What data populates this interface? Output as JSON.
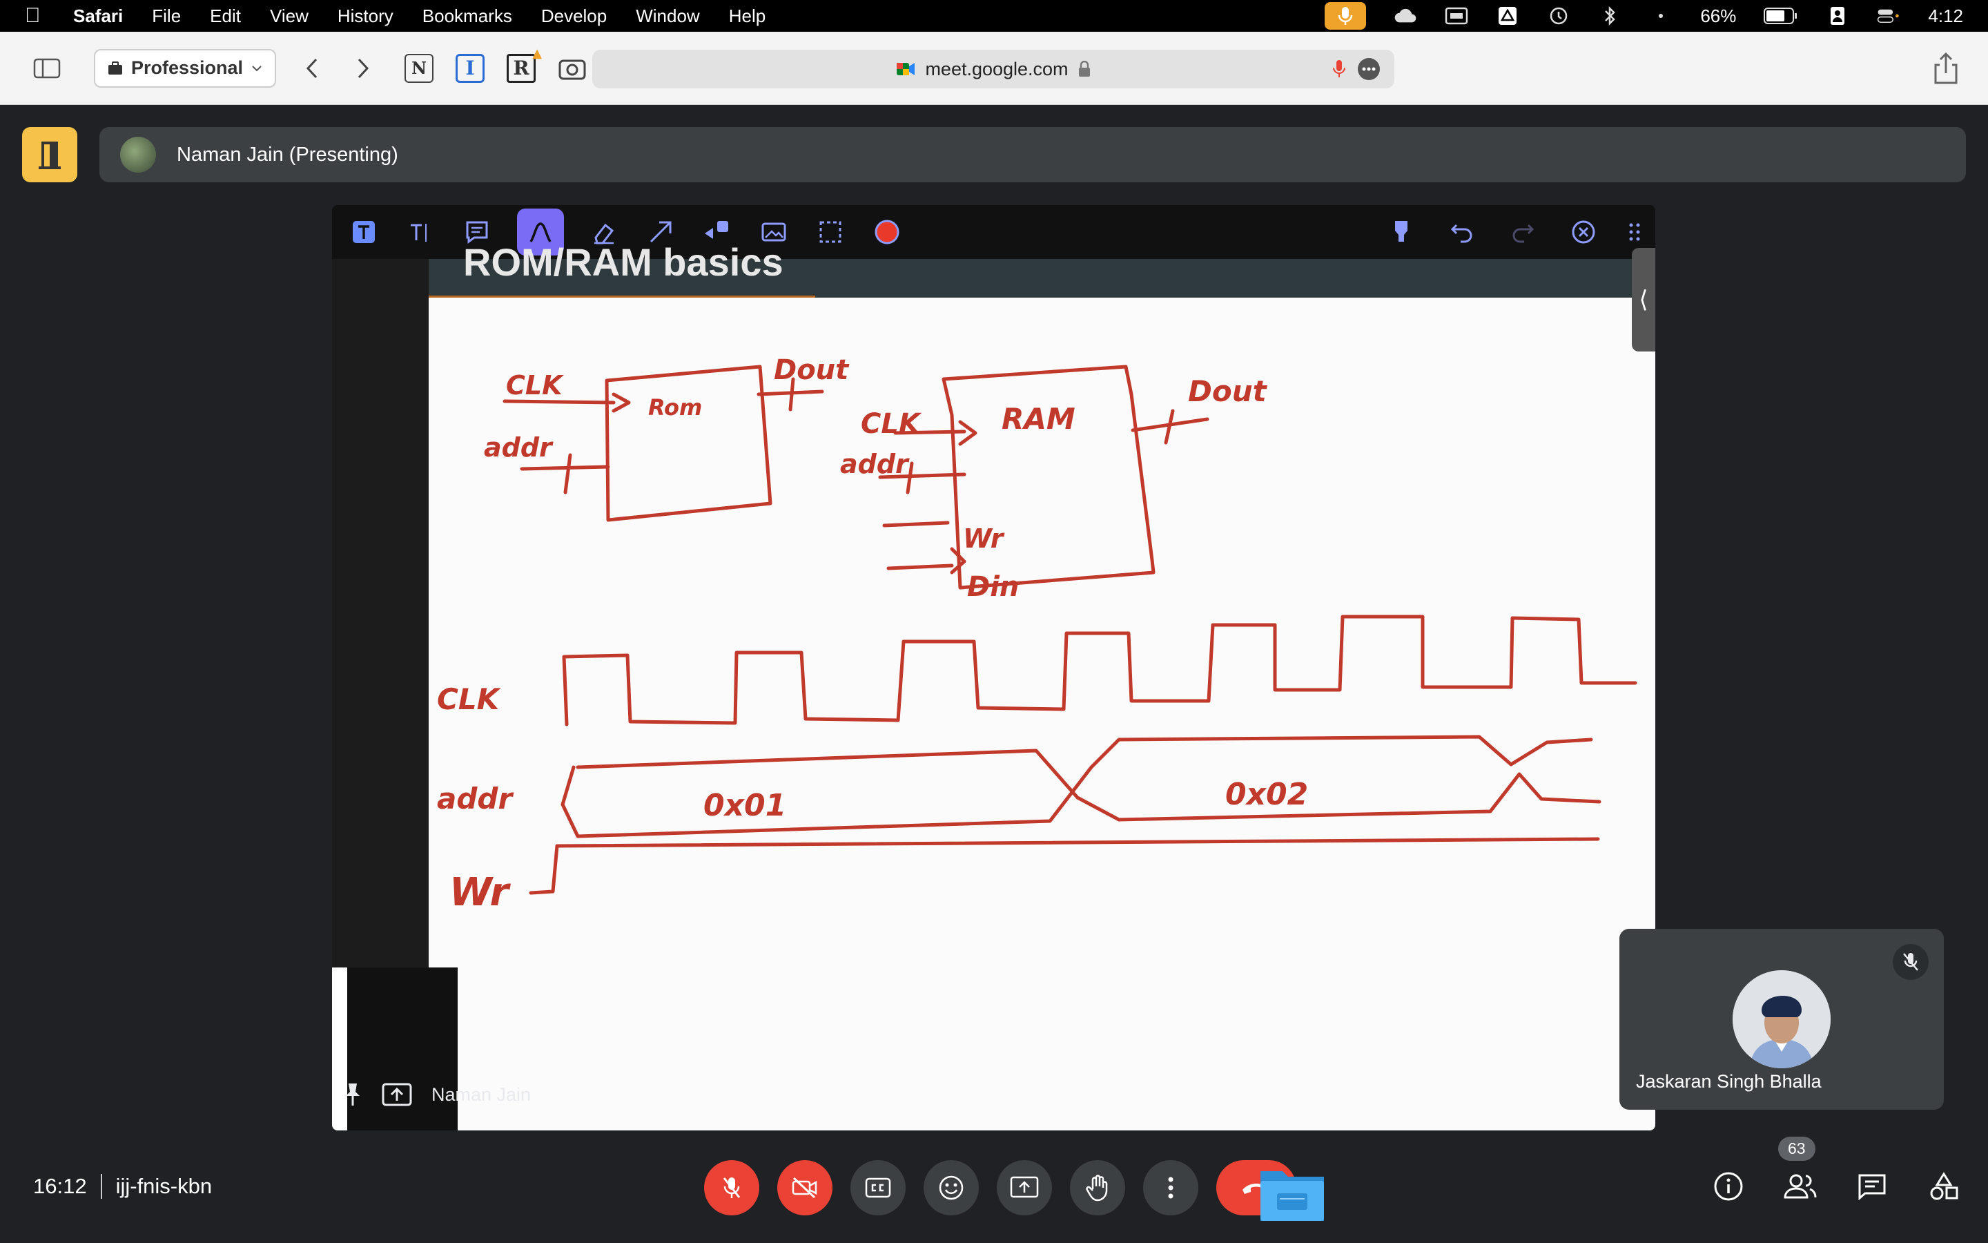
{
  "menubar": {
    "app": "Safari",
    "items": [
      "File",
      "Edit",
      "View",
      "History",
      "Bookmarks",
      "Develop",
      "Window",
      "Help"
    ],
    "battery": "66%",
    "clock": "4:12"
  },
  "toolbar": {
    "profile": "Professional",
    "url": "meet.google.com",
    "ext_n": "N",
    "ext_i": "I",
    "ext_r": "R"
  },
  "meet": {
    "presenter_label": "Naman Jain (Presenting)",
    "self_tile_name": "Naman Jain",
    "participant_name": "Jaskaran Singh Bhalla",
    "time": "16:12",
    "meeting_code": "ijj-fnis-kbn",
    "participant_count": "63"
  },
  "colors": {
    "accent_yellow": "#f6c24a",
    "end_call_red": "#ea4335",
    "annot_active": "#7b6cf6",
    "ink": "#c0392b"
  },
  "whiteboard": {
    "title_partial": "ROM/RAM basics",
    "rom": {
      "label": "Rom",
      "clk": "CLK",
      "addr": "addr",
      "dout": "Dout"
    },
    "ram": {
      "label": "RAM",
      "clk": "CLK",
      "addr": "addr",
      "wr": "Wr",
      "din": "Din",
      "dout": "Dout"
    },
    "timing": {
      "clk": "CLK",
      "addr": "addr",
      "wr": "Wr",
      "val1": "0x01",
      "val2": "0x02"
    }
  }
}
